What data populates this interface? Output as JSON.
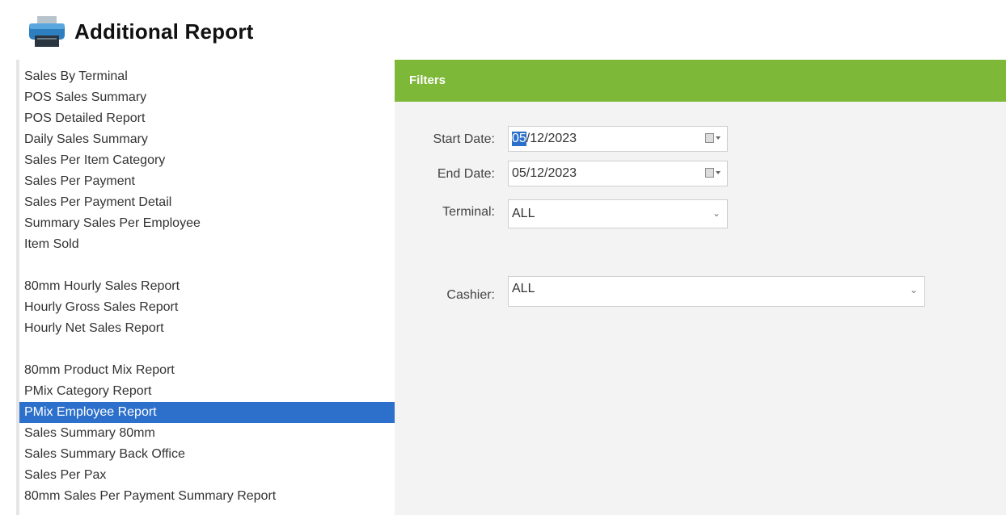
{
  "header": {
    "title": "Additional Report",
    "icon": "printer-icon"
  },
  "reports": {
    "group1": [
      "Sales By Terminal",
      "POS Sales Summary",
      "POS Detailed Report",
      "Daily Sales Summary",
      "Sales Per Item Category",
      "Sales Per Payment",
      "Sales Per Payment Detail",
      "Summary Sales Per Employee",
      "Item Sold"
    ],
    "group2": [
      "80mm Hourly Sales Report",
      "Hourly Gross Sales Report",
      "Hourly Net Sales Report"
    ],
    "group3": [
      "80mm Product Mix Report",
      "PMix Category Report",
      "PMix Employee Report",
      "Sales Summary 80mm",
      "Sales Summary Back Office",
      "Sales Per Pax",
      "80mm Sales Per Payment Summary Report"
    ],
    "selected": "PMix Employee Report"
  },
  "filters": {
    "title": "Filters",
    "start_date": {
      "label": "Start Date:",
      "value_selected": "05",
      "value_rest": "/12/2023"
    },
    "end_date": {
      "label": "End Date:",
      "value": "05/12/2023"
    },
    "terminal": {
      "label": "Terminal:",
      "value": "ALL"
    },
    "cashier": {
      "label": "Cashier:",
      "value": "ALL"
    }
  },
  "colors": {
    "filters_bar": "#7db838",
    "selection": "#2c70cc"
  }
}
